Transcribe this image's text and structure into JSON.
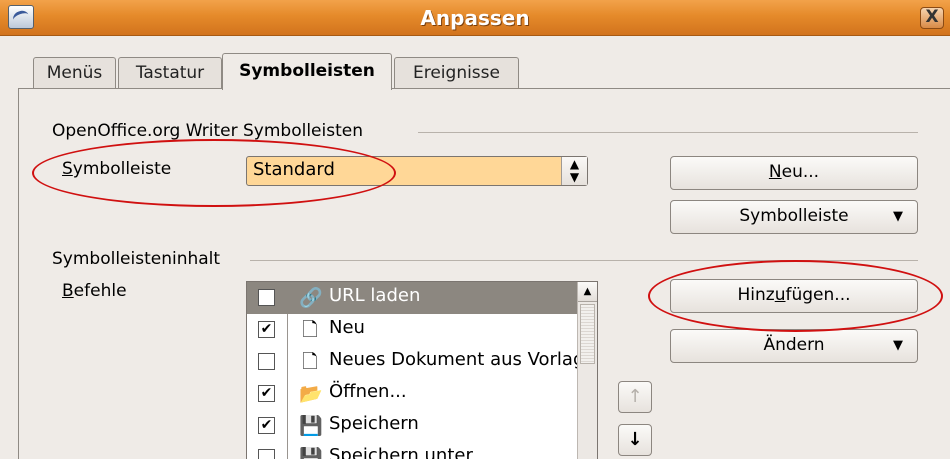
{
  "window": {
    "title": "Anpassen",
    "close_label": "X"
  },
  "tabs": [
    {
      "label": "Menüs"
    },
    {
      "label": "Tastatur"
    },
    {
      "label": "Symbolleisten"
    },
    {
      "label": "Ereignisse"
    }
  ],
  "toolbars_section": {
    "heading": "OpenOffice.org Writer Symbolleisten",
    "toolbar_label": "Symbolleiste",
    "toolbar_value": "Standard",
    "new_button": "Neu...",
    "toolbar_menu_button": "Symbolleiste"
  },
  "content_section": {
    "heading": "Symbolleisteninhalt",
    "commands_label": "Befehle",
    "add_button": "Hinzufügen...",
    "modify_button": "Ändern",
    "items": [
      {
        "label": "URL laden",
        "checked": false,
        "icon": "url-load-icon"
      },
      {
        "label": "Neu",
        "checked": true,
        "icon": "new-document-icon"
      },
      {
        "label": "Neues Dokument aus Vorlage",
        "checked": false,
        "icon": "new-document-icon"
      },
      {
        "label": "Öffnen...",
        "checked": true,
        "icon": "open-folder-icon"
      },
      {
        "label": "Speichern",
        "checked": true,
        "icon": "save-icon"
      },
      {
        "label": "Speichern unter",
        "checked": false,
        "icon": "save-as-icon"
      }
    ]
  },
  "icons": {
    "up": "↑",
    "down": "↓",
    "dropdown": "▼",
    "check": "✔"
  }
}
